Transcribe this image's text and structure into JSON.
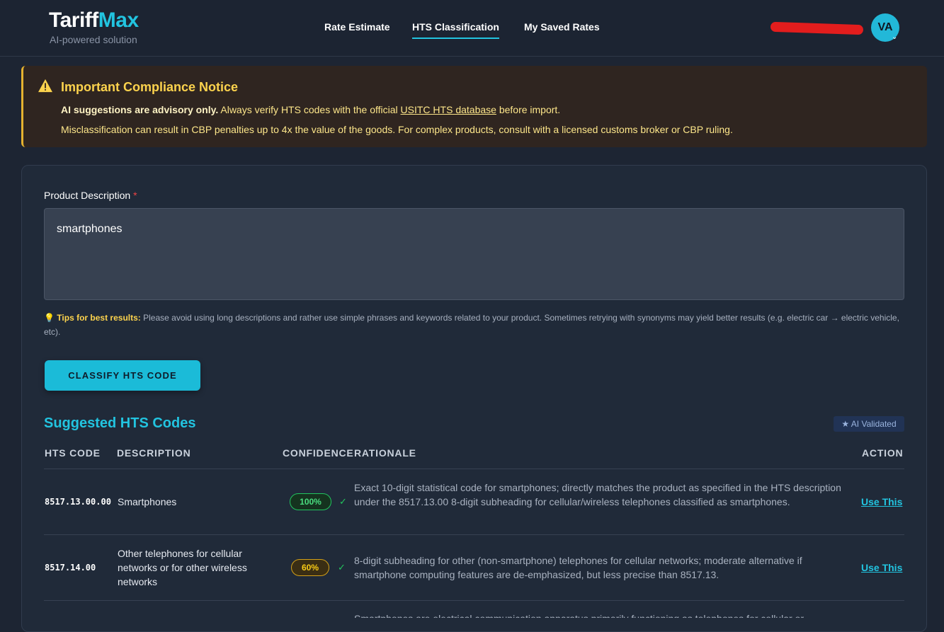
{
  "header": {
    "logo_part1": "Tariff",
    "logo_part2": "Max",
    "tagline": "AI-powered solution",
    "nav": [
      {
        "label": "Rate Estimate",
        "active": false
      },
      {
        "label": "HTS Classification",
        "active": true
      },
      {
        "label": "My Saved Rates",
        "active": false
      }
    ],
    "user_initials": "VA"
  },
  "notice": {
    "title": "Important Compliance Notice",
    "line1_bold": "AI suggestions are advisory only.",
    "line1_text": "Always verify HTS codes with the official",
    "line1_link": "USITC HTS database",
    "line1_end": "before import.",
    "line2": "Misclassification can result in CBP penalties up to 4x the value of the goods. For complex products, consult with a licensed customs broker or CBP ruling."
  },
  "form": {
    "label": "Product Description",
    "required_mark": "*",
    "value": "smartphones",
    "tips_bold": "Tips for best results:",
    "tips_text": "Please avoid using long descriptions and rather use simple phrases and keywords related to your product. Sometimes retrying with synonyms may yield better results (e.g. electric car → electric vehicle, etc).",
    "button": "CLASSIFY HTS CODE"
  },
  "results": {
    "title": "Suggested HTS Codes",
    "badge": "★ AI Validated",
    "columns": [
      "HTS CODE",
      "DESCRIPTION",
      "CONFIDENCE",
      "RATIONALE",
      "ACTION"
    ],
    "rows": [
      {
        "code": "8517.13.00.00",
        "description": "Smartphones",
        "confidence": "100%",
        "rationale": "Exact 10-digit statistical code for smartphones; directly matches the product as specified in the HTS description under the 8517.13.00 8-digit subheading for cellular/wireless telephones classified as smartphones.",
        "action": "Use This"
      },
      {
        "code": "8517.14.00",
        "description": "Other telephones for cellular networks or for other wireless networks",
        "confidence": "60%",
        "rationale": "8-digit subheading for other (non-smartphone) telephones for cellular networks; moderate alternative if smartphone computing features are de-emphasized, but less precise than 8517.13.",
        "action": "Use This"
      },
      {
        "rationale": "Smartphones are electrical communication apparatus primarily functioning as telephones for cellular or"
      }
    ]
  },
  "colors": {
    "accent": "#22c4e0",
    "warning": "#fcd34d",
    "success": "#22c55e"
  }
}
